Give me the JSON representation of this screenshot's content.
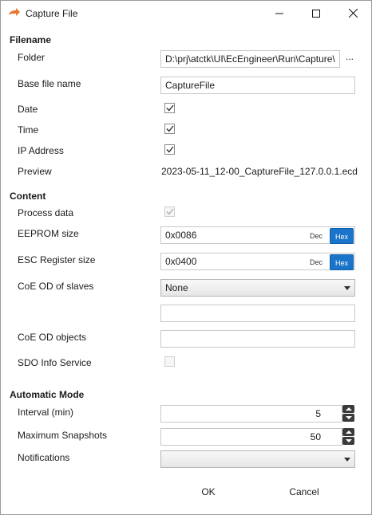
{
  "window": {
    "title": "Capture File",
    "icon": "capture-arrow-icon",
    "controls": [
      "minimize-icon",
      "maximize-icon",
      "close-icon"
    ]
  },
  "filename": {
    "heading": "Filename",
    "folder_label": "Folder",
    "folder_value": "D:\\prj\\atctk\\UI\\EcEngineer\\Run\\Capture\\",
    "browse_label": "...",
    "base_label": "Base file name",
    "base_value": "CaptureFile",
    "date_label": "Date",
    "date_checked": true,
    "time_label": "Time",
    "time_checked": true,
    "ip_label": "IP Address",
    "ip_checked": true,
    "preview_label": "Preview",
    "preview_value": "2023-05-11_12-00_CaptureFile_127.0.0.1.ecd"
  },
  "content": {
    "heading": "Content",
    "process_label": "Process data",
    "process_checked": true,
    "eeprom_label": "EEPROM size",
    "eeprom_value": "0x0086",
    "esc_label": "ESC Register size",
    "esc_value": "0x0400",
    "dec_label": "Dec",
    "hex_label": "Hex",
    "coe_slaves_label": "CoE OD of slaves",
    "coe_slaves_value": "None",
    "coe_objects_label": "CoE OD objects",
    "sdo_label": "SDO Info Service",
    "sdo_checked": false
  },
  "auto": {
    "heading": "Automatic Mode",
    "interval_label": "Interval (min)",
    "interval_value": "5",
    "max_label": "Maximum Snapshots",
    "max_value": "50",
    "notif_label": "Notifications",
    "notif_value": ""
  },
  "buttons": {
    "ok": "OK",
    "cancel": "Cancel"
  },
  "colors": {
    "accent": "#1a74c9",
    "icon_orange": "#e8772e"
  }
}
